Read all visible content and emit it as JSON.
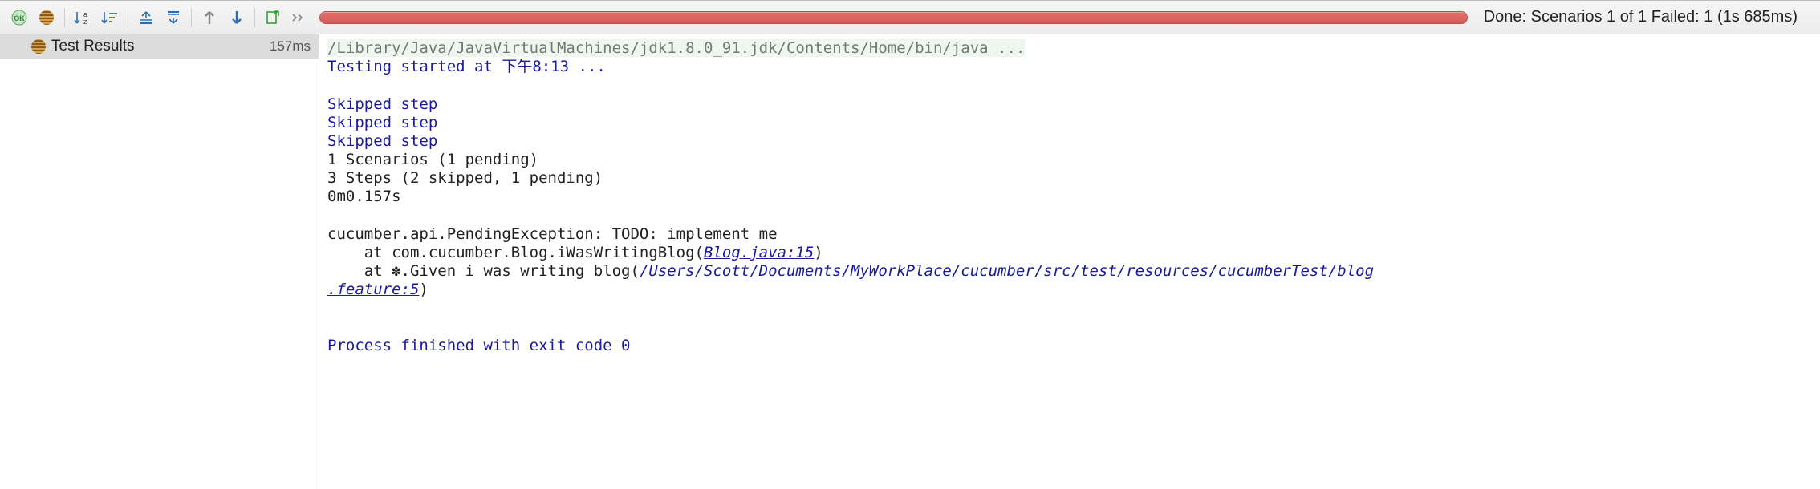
{
  "status_text": "Done: Scenarios 1 of 1  Failed: 1  (1s 685ms)",
  "tree": {
    "root_label": "Test Results",
    "root_time": "157ms"
  },
  "console": {
    "cmd": "/Library/Java/JavaVirtualMachines/jdk1.8.0_91.jdk/Contents/Home/bin/java ...",
    "started": "Testing started at 下午8:13 ...",
    "skip1": "Skipped step",
    "skip2": "Skipped step",
    "skip3": "Skipped step",
    "scen": "1 Scenarios (1 pending)",
    "steps": "3 Steps (2 skipped, 1 pending)",
    "dur": "0m0.157s",
    "exc": "cucumber.api.PendingException: TODO: implement me",
    "at1_pre": "    at com.cucumber.Blog.iWasWritingBlog(",
    "at1_link": "Blog.java:15",
    "at1_post": ")",
    "at2_pre": "    at ✽.Given i was writing blog(",
    "at2_link": "/Users/Scott/Documents/MyWorkPlace/cucumber/src/test/resources/cucumberTest/blog",
    "at2_cont": ".feature:5",
    "at2_post": ")",
    "exit": "Process finished with exit code 0"
  }
}
